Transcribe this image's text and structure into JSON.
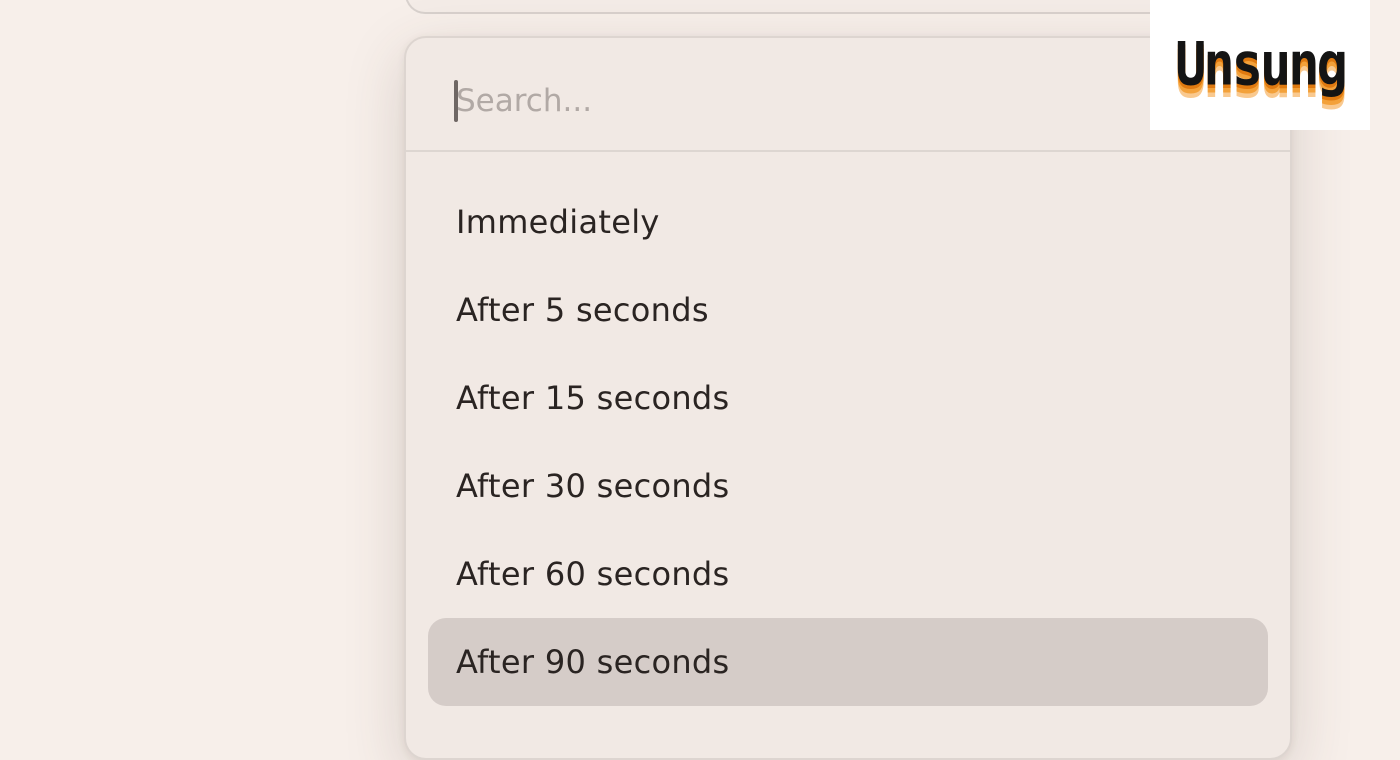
{
  "search": {
    "placeholder": "Search...",
    "value": ""
  },
  "options": [
    {
      "label": "Immediately",
      "selected": false
    },
    {
      "label": "After 5 seconds",
      "selected": false
    },
    {
      "label": "After 15 seconds",
      "selected": false
    },
    {
      "label": "After 30 seconds",
      "selected": false
    },
    {
      "label": "After 60 seconds",
      "selected": false
    },
    {
      "label": "After 90 seconds",
      "selected": true
    }
  ],
  "watermark": {
    "text": "Unsung"
  },
  "colors": {
    "background": "#f7efea",
    "panel": "#f1e9e4",
    "selected_row": "#d5ccc8",
    "text": "#2a2422",
    "placeholder": "#b1a9a5",
    "logo_accent": "#e07a10"
  }
}
